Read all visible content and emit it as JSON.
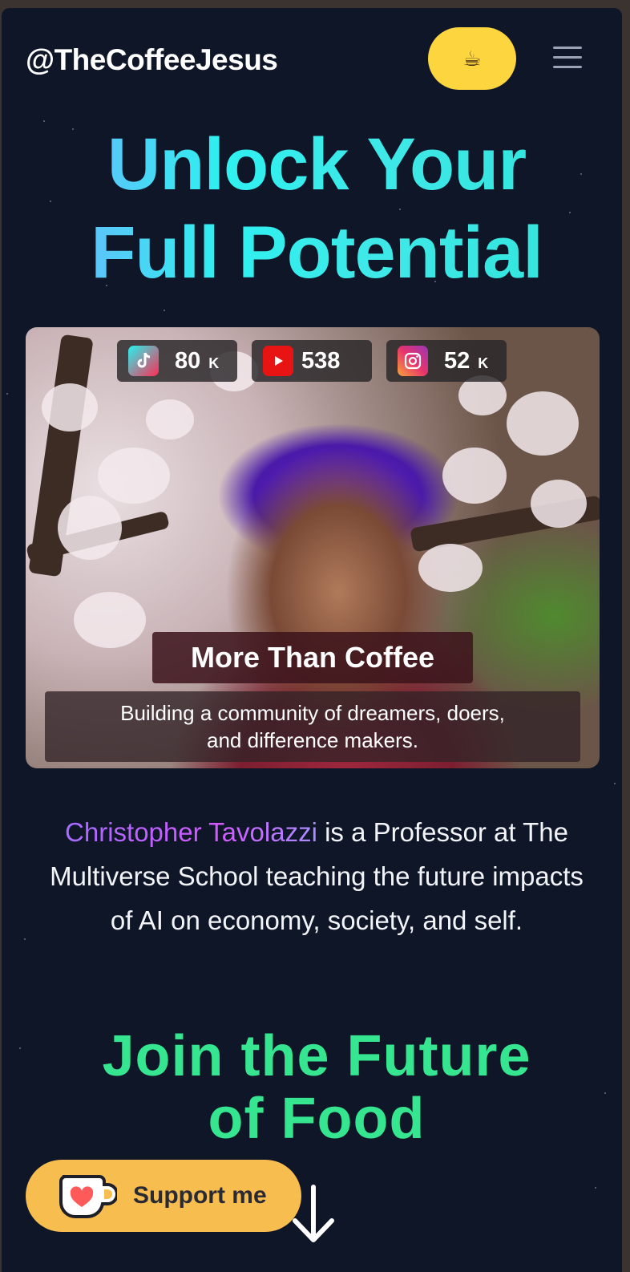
{
  "header": {
    "brand": "@TheCoffeeJesus",
    "coffee_button_icon": "☕",
    "menu_icon": "hamburger-menu-icon"
  },
  "hero": {
    "title_line1": "Unlock Your",
    "title_line2": "Full Potential"
  },
  "stats": [
    {
      "platform": "tiktok",
      "icon": "tiktok-icon",
      "value": "80",
      "unit": "K"
    },
    {
      "platform": "youtube",
      "icon": "youtube-icon",
      "value": "538",
      "unit": ""
    },
    {
      "platform": "instagram",
      "icon": "instagram-icon",
      "value": "52",
      "unit": "K"
    }
  ],
  "photo": {
    "caption_title": "More Than Coffee",
    "caption_line1": "Building a community of dreamers, doers,",
    "caption_line2": "and difference makers."
  },
  "bio": {
    "name": "Christopher Tavolazzi",
    "text": " is a Professor at The Multiverse School teaching the future impacts of AI on economy, society, and self."
  },
  "join": {
    "line1": "Join the Future",
    "line2": "of Food"
  },
  "support": {
    "label": "Support me",
    "icon": "kofi-cup-icon"
  },
  "colors": {
    "background": "#0f1628",
    "accent_yellow": "#fcd53f",
    "support_orange": "#f8bd4f",
    "join_green": "#36e58f",
    "hero_gradient_start": "#7aa6ff",
    "hero_gradient_end": "#2de4d8"
  }
}
